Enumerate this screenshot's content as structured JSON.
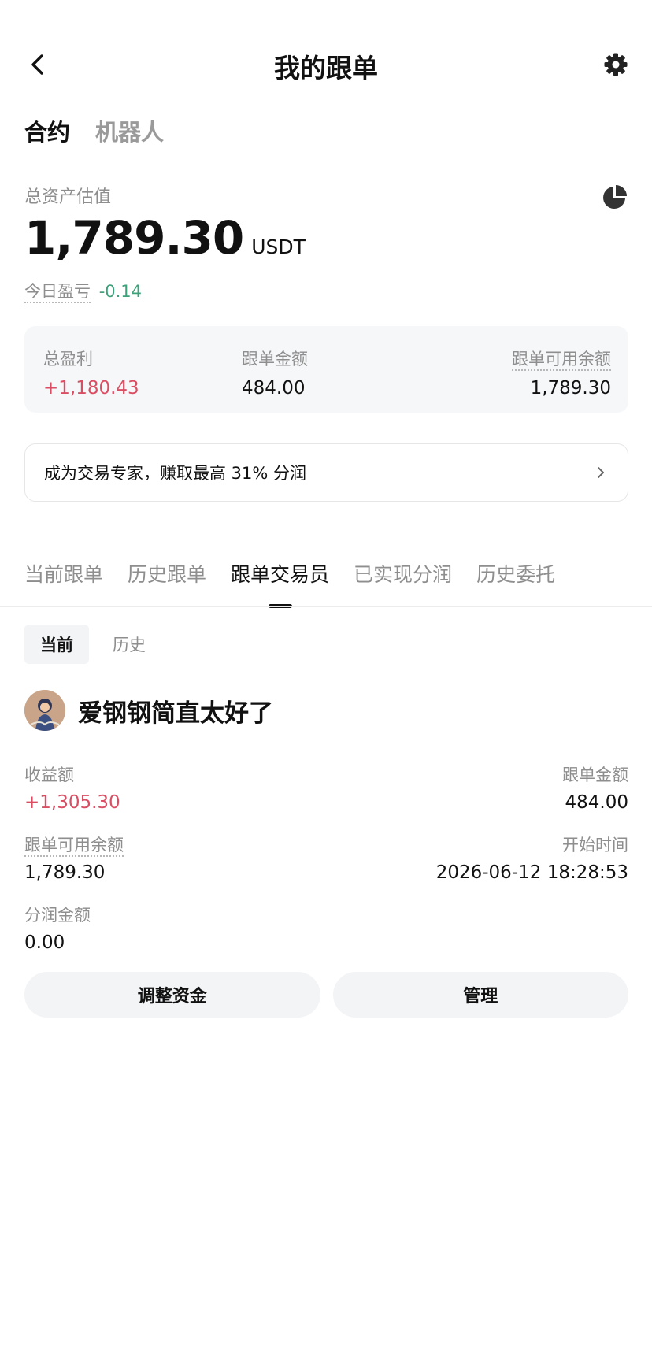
{
  "header": {
    "title": "我的跟单"
  },
  "top_tabs": [
    {
      "label": "合约",
      "active": true
    },
    {
      "label": "机器人",
      "active": false
    }
  ],
  "asset": {
    "label": "总资产估值",
    "value": "1,789.30",
    "unit": "USDT",
    "today_label": "今日盈亏",
    "today_value": "-0.14"
  },
  "summary": {
    "total_profit_label": "总盈利",
    "total_profit_value": "+1,180.43",
    "copy_amount_label": "跟单金额",
    "copy_amount_value": "484.00",
    "available_label": "跟单可用余额",
    "available_value": "1,789.30"
  },
  "promo": {
    "text": "成为交易专家，赚取最高 31% 分润"
  },
  "tabs": [
    {
      "label": "当前跟单"
    },
    {
      "label": "历史跟单"
    },
    {
      "label": "跟单交易员",
      "active": true
    },
    {
      "label": "已实现分润"
    },
    {
      "label": "历史委托"
    }
  ],
  "segment": [
    {
      "label": "当前",
      "active": true
    },
    {
      "label": "历史",
      "active": false
    }
  ],
  "trader": {
    "name": "爱钢钢简直太好了",
    "earnings_label": "收益额",
    "earnings_value": "+1,305.30",
    "copy_amount_label": "跟单金额",
    "copy_amount_value": "484.00",
    "available_label": "跟单可用余额",
    "available_value": "1,789.30",
    "start_time_label": "开始时间",
    "start_time_value": "2026-06-12 18:28:53",
    "share_label": "分润金额",
    "share_value": "0.00"
  },
  "buttons": {
    "adjust_funds": "调整资金",
    "manage": "管理"
  },
  "colors": {
    "positive": "#d94e63",
    "negative": "#3ea17a",
    "muted": "#8e8e8e"
  }
}
